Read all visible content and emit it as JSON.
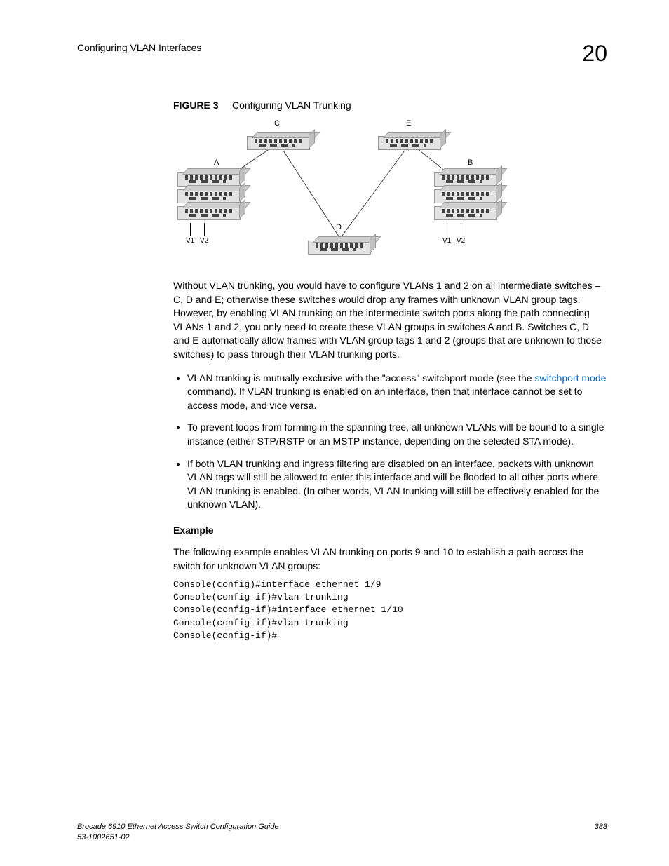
{
  "header": {
    "section_title": "Configuring VLAN Interfaces",
    "chapter_number": "20"
  },
  "figure": {
    "label": "FIGURE 3",
    "title": "Configuring VLAN Trunking",
    "nodes": {
      "A": "A",
      "B": "B",
      "C": "C",
      "D": "D",
      "E": "E"
    },
    "vlabels": {
      "v1": "V1",
      "v2": "V2"
    }
  },
  "paragraphs": {
    "p1": "Without VLAN trunking, you would have to configure VLANs 1 and 2 on all intermediate switches – C, D and E; otherwise these switches would drop any frames with unknown VLAN group tags. However, by enabling VLAN trunking on the intermediate switch ports along the path connecting VLANs 1 and 2, you only need to create these VLAN groups in switches A and B. Switches C, D and E automatically allow frames with VLAN group tags 1 and 2 (groups that are unknown to those switches) to pass through their VLAN trunking ports."
  },
  "bullets": {
    "b1_pre": "VLAN trunking is mutually exclusive with the \"access\" switchport mode (see the ",
    "b1_link": "switchport mode",
    "b1_post": " command). If VLAN trunking is enabled on an interface, then that interface cannot be set to access mode, and vice versa.",
    "b2": "To prevent loops from forming in the spanning tree, all unknown VLANs will be bound to a single instance (either STP/RSTP or an MSTP instance, depending on the selected STA mode).",
    "b3": "If both VLAN trunking and ingress filtering are disabled on an interface, packets with unknown VLAN tags will still be allowed to enter this interface and will be flooded to all other ports where VLAN trunking is enabled. (In other words, VLAN trunking will still be effectively enabled for the unknown VLAN)."
  },
  "example": {
    "heading": "Example",
    "intro": "The following example enables VLAN trunking on ports 9 and 10 to establish a path across the switch for unknown VLAN groups:",
    "code": "Console(config)#interface ethernet 1/9\nConsole(config-if)#vlan-trunking\nConsole(config-if)#interface ethernet 1/10\nConsole(config-if)#vlan-trunking\nConsole(config-if)#"
  },
  "footer": {
    "left_line1": "Brocade 6910 Ethernet Access Switch Configuration Guide",
    "left_line2": "53-1002651-02",
    "page": "383"
  }
}
